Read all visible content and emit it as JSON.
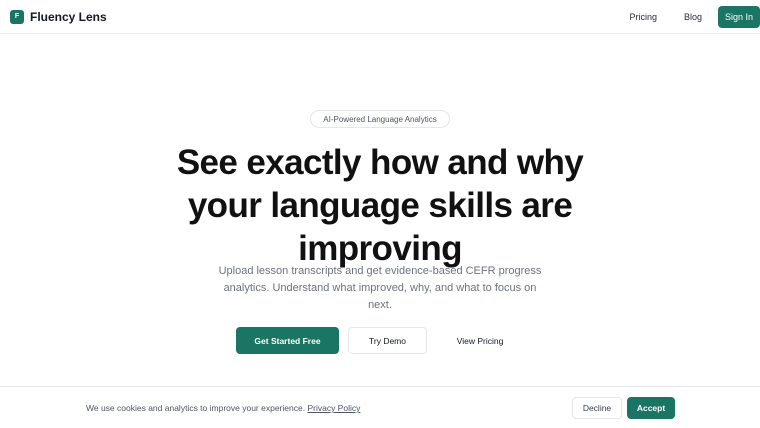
{
  "header": {
    "logo_letter": "F",
    "brand": "Fluency Lens",
    "nav": {
      "pricing": "Pricing",
      "blog": "Blog",
      "signin": "Sign In"
    }
  },
  "hero": {
    "badge": "AI-Powered Language Analytics",
    "headline_lines": [
      "See exactly how and why",
      "your language skills are",
      "improving"
    ],
    "subtext_lines": [
      "Upload lesson transcripts and get evidence-based CEFR progress",
      "analytics. Understand what improved, why, and what to focus on",
      "next."
    ],
    "buttons": {
      "primary": "Get Started Free",
      "demo": "Try Demo",
      "pricing": "View Pricing"
    }
  },
  "cookie_banner": {
    "text": "We use cookies and analytics to improve your experience.",
    "link": "Privacy Policy",
    "decline": "Decline",
    "accept": "Accept"
  },
  "colors": {
    "accent": "#1a7565",
    "text": "#111827",
    "muted": "#6b7280",
    "border": "#e5e7eb"
  }
}
